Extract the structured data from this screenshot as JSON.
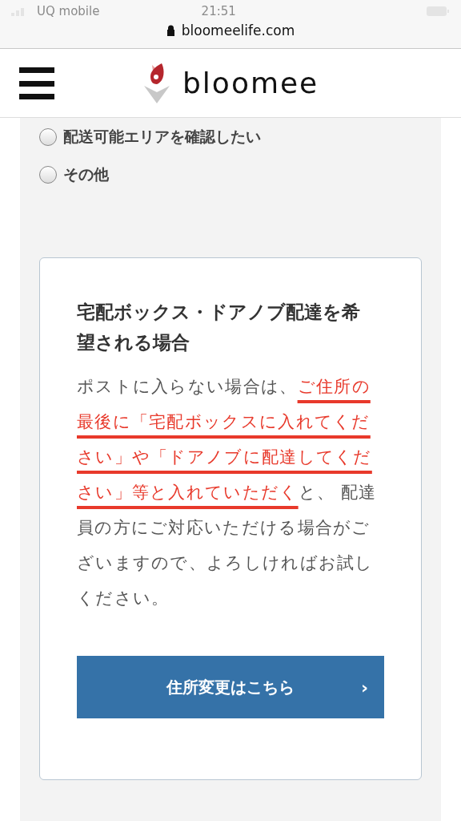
{
  "status_bar": {
    "carrier": "UQ mobile",
    "time": "21:51"
  },
  "address_bar": {
    "url": "bloomeelife.com"
  },
  "header": {
    "logo_text": "bloomee"
  },
  "options": [
    {
      "label": "配送可能エリアを確認したい",
      "selected": false
    },
    {
      "label": "その他",
      "selected": false
    }
  ],
  "card": {
    "title": "宅配ボックス・ドアノブ配達を希望される場合",
    "paragraph": {
      "before": "ポストに入らない場合は、",
      "highlight": "ご住所の最後に「宅配ボックスに入れてください」や「ドアノブに配達してください」等と入れていただく",
      "after": "と、 配達員の方にご対応いただける場合がございますので、よろしければお試しください。"
    },
    "button": {
      "label": "住所変更はこちら",
      "chevron": "›"
    }
  }
}
